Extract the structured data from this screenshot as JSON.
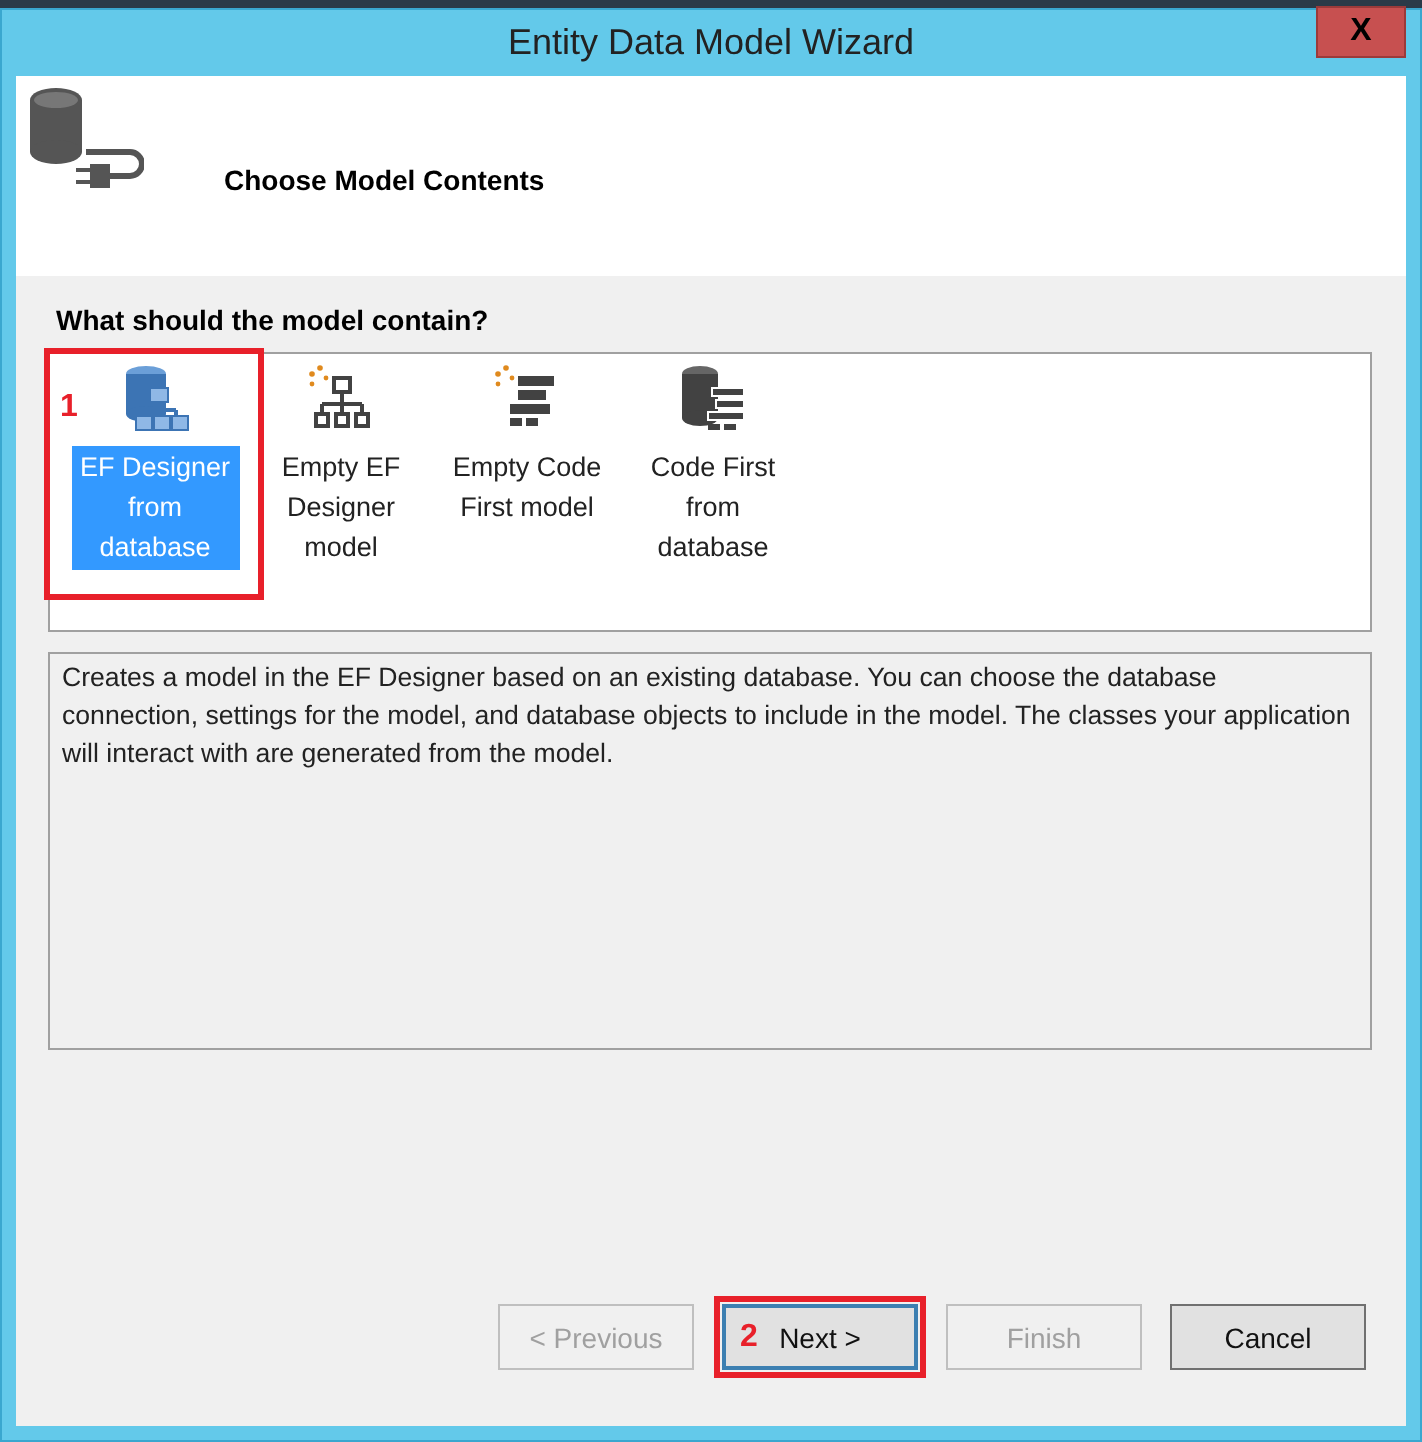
{
  "window": {
    "title": "Entity Data Model Wizard",
    "close": "X"
  },
  "header": {
    "title": "Choose Model Contents"
  },
  "model_section": {
    "label": "What should the model contain?",
    "options": [
      {
        "kind": "designer-db",
        "label": "EF Designer from database",
        "selected": true,
        "annotation": "1"
      },
      {
        "kind": "designer-empty",
        "label": "Empty EF Designer model",
        "selected": false
      },
      {
        "kind": "code-empty",
        "label": "Empty Code First model",
        "selected": false
      },
      {
        "kind": "code-db",
        "label": "Code First from database",
        "selected": false
      }
    ]
  },
  "description": "Creates a model in the EF Designer based on an existing database. You can choose the database connection, settings for the model, and database objects to include in the model. The classes your application will interact with are generated from the model.",
  "buttons": [
    {
      "label": "< Previous",
      "disabled": true,
      "default": false
    },
    {
      "label": "Next >",
      "disabled": false,
      "default": true,
      "annotation": "2"
    },
    {
      "label": "Finish",
      "disabled": true,
      "default": false
    },
    {
      "label": "Cancel",
      "disabled": false,
      "default": false
    }
  ]
}
